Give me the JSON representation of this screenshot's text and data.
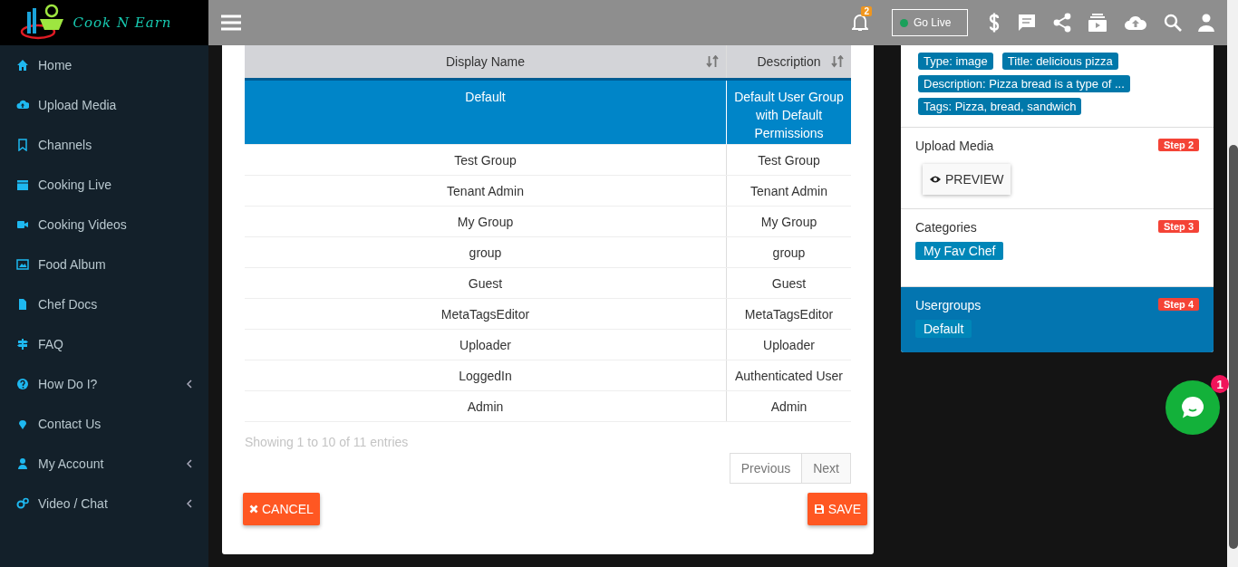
{
  "logo": {
    "text": "Cook N Earn"
  },
  "sidebar": {
    "items": [
      {
        "label": "Home",
        "has_children": false
      },
      {
        "label": "Upload Media",
        "has_children": false
      },
      {
        "label": "Channels",
        "has_children": false
      },
      {
        "label": "Cooking Live",
        "has_children": false
      },
      {
        "label": "Cooking Videos",
        "has_children": false
      },
      {
        "label": "Food Album",
        "has_children": false
      },
      {
        "label": "Chef Docs",
        "has_children": false
      },
      {
        "label": "FAQ",
        "has_children": false
      },
      {
        "label": "How Do I?",
        "has_children": true
      },
      {
        "label": "Contact Us",
        "has_children": false
      },
      {
        "label": "My Account",
        "has_children": true
      },
      {
        "label": "Video / Chat",
        "has_children": true
      }
    ]
  },
  "top_bar": {
    "notification_count": "2",
    "go_live": "Go Live"
  },
  "table": {
    "columns": [
      "Display Name",
      "Description"
    ],
    "rows": [
      {
        "cells": [
          "Default",
          "Default User Group with Default Permissions"
        ],
        "selected": true
      },
      {
        "cells": [
          "Test Group",
          "Test Group"
        ],
        "selected": false
      },
      {
        "cells": [
          "Tenant Admin",
          "Tenant Admin"
        ],
        "selected": false
      },
      {
        "cells": [
          "My Group",
          "My Group"
        ],
        "selected": false
      },
      {
        "cells": [
          "group",
          "group"
        ],
        "selected": false
      },
      {
        "cells": [
          "Guest",
          "Guest"
        ],
        "selected": false
      },
      {
        "cells": [
          "MetaTagsEditor",
          "MetaTagsEditor"
        ],
        "selected": false
      },
      {
        "cells": [
          "Uploader",
          "Uploader"
        ],
        "selected": false
      },
      {
        "cells": [
          "LoggedIn",
          "Authenticated User"
        ],
        "selected": false
      },
      {
        "cells": [
          "Admin",
          "Admin"
        ],
        "selected": false
      }
    ],
    "info": "Showing 1 to 10 of 11 entries",
    "pagination": [
      "Previous",
      "Next"
    ]
  },
  "buttons": {
    "cancel": "CANCEL",
    "save": "SAVE"
  },
  "summary": {
    "tags": [
      "Type: image",
      "Title: delicious pizza",
      "Description: Pizza bread is a type of ...",
      "Tags: Pizza, bread, sandwich"
    ],
    "steps": [
      {
        "kind": "preview",
        "title": "Upload Media",
        "step": "Step 2",
        "button": "PREVIEW",
        "selected": false
      },
      {
        "kind": "chips",
        "title": "Categories",
        "step": "Step 3",
        "chips": [
          "My Fav Chef"
        ],
        "selected": false
      },
      {
        "kind": "chips",
        "title": "Usergroups",
        "step": "Step 4",
        "chips": [
          "Default"
        ],
        "selected": true
      }
    ]
  },
  "chat": {
    "badge": "1"
  }
}
